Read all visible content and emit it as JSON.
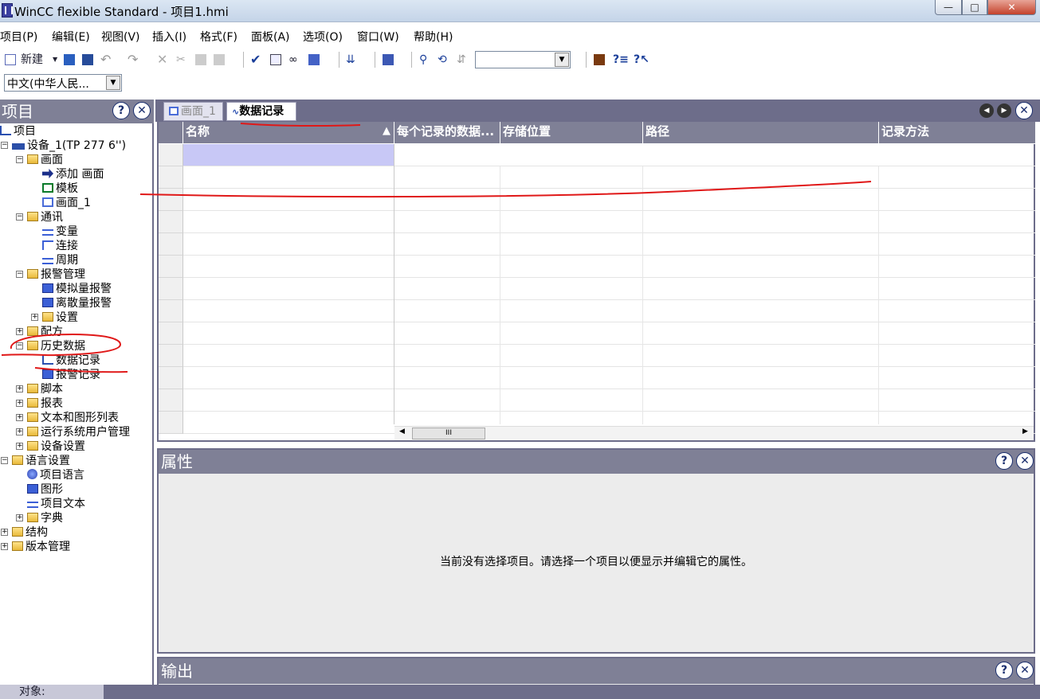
{
  "window": {
    "title": "WinCC flexible Standard - 项目1.hmi",
    "minimize": "—",
    "maximize": "□",
    "close": "✕"
  },
  "menu": [
    "项目(P)",
    "编辑(E)",
    "视图(V)",
    "插入(I)",
    "格式(F)",
    "面板(A)",
    "选项(O)",
    "窗口(W)",
    "帮助(H)"
  ],
  "toolbar": {
    "new_label": "新建",
    "language": "中文(中华人民..."
  },
  "left_panel": {
    "title": "项目",
    "tree": [
      {
        "label": "项目",
        "depth": 0,
        "exp": "",
        "icon": "chart"
      },
      {
        "label": "设备_1(TP 277 6'')",
        "depth": 0,
        "exp": "−",
        "icon": "device"
      },
      {
        "label": "画面",
        "depth": 1,
        "exp": "−",
        "icon": "folder"
      },
      {
        "label": "添加 画面",
        "depth": 2,
        "exp": "",
        "icon": "arrow"
      },
      {
        "label": "模板",
        "depth": 2,
        "exp": "",
        "icon": "green"
      },
      {
        "label": "画面_1",
        "depth": 2,
        "exp": "",
        "icon": "frame"
      },
      {
        "label": "通讯",
        "depth": 1,
        "exp": "−",
        "icon": "folder"
      },
      {
        "label": "变量",
        "depth": 2,
        "exp": "",
        "icon": "var"
      },
      {
        "label": "连接",
        "depth": 2,
        "exp": "",
        "icon": "conn"
      },
      {
        "label": "周期",
        "depth": 2,
        "exp": "",
        "icon": "var"
      },
      {
        "label": "报警管理",
        "depth": 1,
        "exp": "−",
        "icon": "folder"
      },
      {
        "label": "模拟量报警",
        "depth": 2,
        "exp": "",
        "icon": "blue"
      },
      {
        "label": "离散量报警",
        "depth": 2,
        "exp": "",
        "icon": "blue"
      },
      {
        "label": "设置",
        "depth": 2,
        "exp": "+",
        "icon": "folder"
      },
      {
        "label": "配方",
        "depth": 1,
        "exp": "+",
        "icon": "folder"
      },
      {
        "label": "历史数据",
        "depth": 1,
        "exp": "−",
        "icon": "folder"
      },
      {
        "label": "数据记录",
        "depth": 2,
        "exp": "",
        "icon": "chart"
      },
      {
        "label": "报警记录",
        "depth": 2,
        "exp": "",
        "icon": "blue"
      },
      {
        "label": "脚本",
        "depth": 1,
        "exp": "+",
        "icon": "folder"
      },
      {
        "label": "报表",
        "depth": 1,
        "exp": "+",
        "icon": "folder"
      },
      {
        "label": "文本和图形列表",
        "depth": 1,
        "exp": "+",
        "icon": "folder"
      },
      {
        "label": "运行系统用户管理",
        "depth": 1,
        "exp": "+",
        "icon": "folder"
      },
      {
        "label": "设备设置",
        "depth": 1,
        "exp": "+",
        "icon": "folder"
      },
      {
        "label": "语言设置",
        "depth": 0,
        "exp": "−",
        "icon": "folder"
      },
      {
        "label": "项目语言",
        "depth": 1,
        "exp": "",
        "icon": "globe"
      },
      {
        "label": "图形",
        "depth": 1,
        "exp": "",
        "icon": "blue"
      },
      {
        "label": "项目文本",
        "depth": 1,
        "exp": "",
        "icon": "var"
      },
      {
        "label": "字典",
        "depth": 1,
        "exp": "+",
        "icon": "folder"
      },
      {
        "label": "结构",
        "depth": 0,
        "exp": "+",
        "icon": "folder"
      },
      {
        "label": "版本管理",
        "depth": 0,
        "exp": "+",
        "icon": "folder"
      }
    ]
  },
  "tabs": [
    {
      "label": "画面_1",
      "active": false
    },
    {
      "label": "数据记录",
      "active": true
    }
  ],
  "grid": {
    "columns": [
      "名称",
      "每个记录的数据...",
      "存储位置",
      "路径",
      "记录方法"
    ],
    "scroll_grip": "III"
  },
  "properties": {
    "title": "属性",
    "message": "当前没有选择项目。请选择一个项目以便显示并编辑它的属性。"
  },
  "output": {
    "title": "输出"
  },
  "status": {
    "object_label": "对象:"
  },
  "panel_buttons": {
    "help": "?",
    "close": "✕"
  },
  "colors": {
    "panel_header": "#7f8096",
    "frame": "#6d6d8a",
    "annotation": "#e01818"
  }
}
